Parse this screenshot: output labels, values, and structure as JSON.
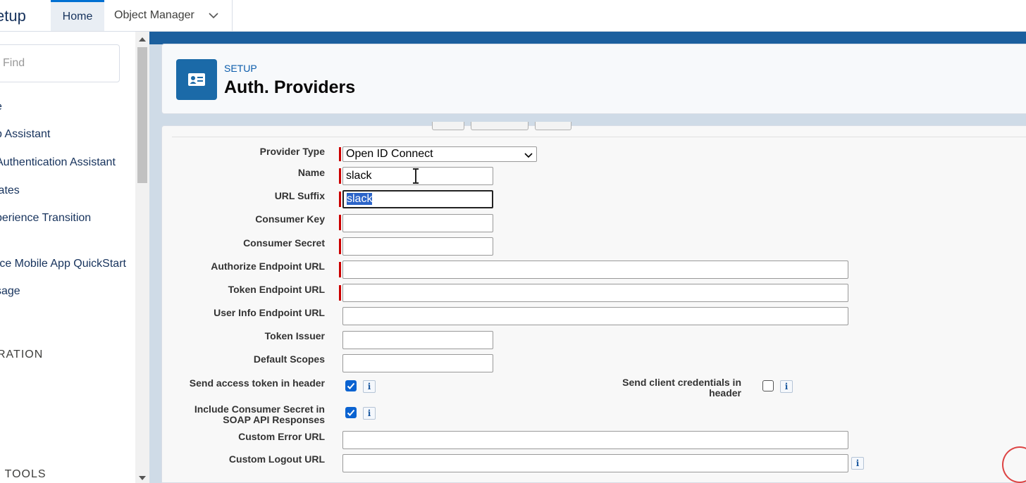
{
  "topbar": {
    "app_title": "etup",
    "tabs": [
      {
        "label": "Home"
      },
      {
        "label": "Object Manager"
      }
    ]
  },
  "sidebar": {
    "search_placeholder": "Find",
    "items": [
      {
        "label": "e"
      },
      {
        "label": "p Assistant"
      },
      {
        "label": " Authentication Assistant"
      },
      {
        "label": "lates"
      },
      {
        "label": "perience Transition"
      },
      {
        "label": "rce Mobile App QuickStart"
      },
      {
        "label": "sage"
      }
    ],
    "sections": [
      {
        "label": "RATION"
      },
      {
        "label": "I TOOLS"
      }
    ]
  },
  "header": {
    "eyebrow": "SETUP",
    "title": "Auth. Providers",
    "icon": "contact-card-icon"
  },
  "form": {
    "provider_type": {
      "label": "Provider Type",
      "value": "Open ID Connect",
      "required": true
    },
    "name": {
      "label": "Name",
      "value": "slack",
      "required": true
    },
    "url_suffix": {
      "label": "URL Suffix",
      "value": "slack",
      "required": true,
      "selected": true
    },
    "consumer_key": {
      "label": "Consumer Key",
      "value": "",
      "required": true
    },
    "consumer_secret": {
      "label": "Consumer Secret",
      "value": "",
      "required": true
    },
    "authorize_endpoint_url": {
      "label": "Authorize Endpoint URL",
      "value": "",
      "required": true
    },
    "token_endpoint_url": {
      "label": "Token Endpoint URL",
      "value": "",
      "required": true
    },
    "user_info_endpoint_url": {
      "label": "User Info Endpoint URL",
      "value": ""
    },
    "token_issuer": {
      "label": "Token Issuer",
      "value": ""
    },
    "default_scopes": {
      "label": "Default Scopes",
      "value": ""
    },
    "send_access_token_in_header": {
      "label": "Send access token in header",
      "checked": true
    },
    "send_client_credentials_line1": "Send client credentials in",
    "send_client_credentials_line2": "header",
    "send_client_credentials_checked": false,
    "include_consumer_secret_line1": "Include Consumer Secret in",
    "include_consumer_secret_line2": "SOAP API Responses",
    "include_consumer_secret_checked": true,
    "custom_error_url": {
      "label": "Custom Error URL",
      "value": ""
    },
    "custom_logout_url": {
      "label": "Custom Logout URL",
      "value": ""
    },
    "info_glyph": "i"
  },
  "colors": {
    "accent": "#0070d2",
    "brand_band": "#1b5f9e",
    "required": "#cc0000",
    "checkbox": "#0b63d1"
  }
}
